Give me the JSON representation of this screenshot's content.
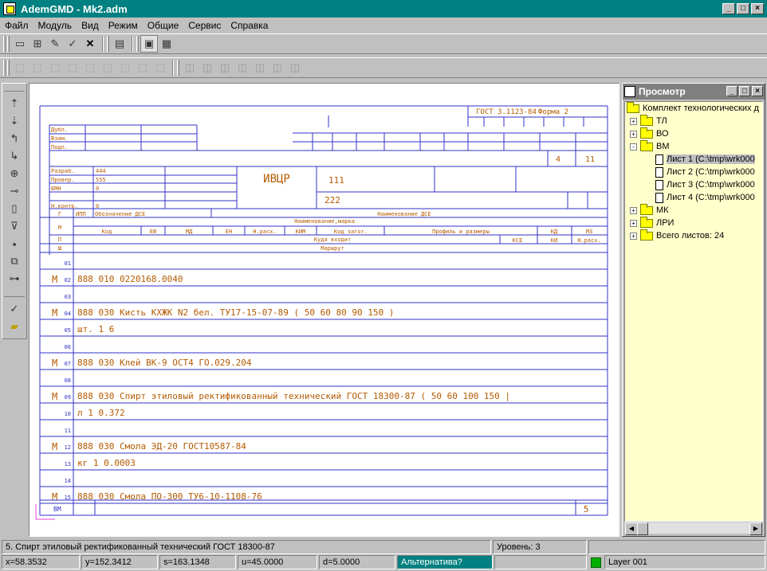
{
  "window": {
    "title": "AdemGMD - Mk2.adm"
  },
  "menu": [
    "Файл",
    "Модуль",
    "Вид",
    "Режим",
    "Общие",
    "Сервис",
    "Справка"
  ],
  "viewer": {
    "title": "Просмотр",
    "root": "Комплект технологических д",
    "folders": [
      "ТЛ",
      "ВО",
      "ВМ"
    ],
    "sheets": [
      "Лист 1 (C:\\tmp\\wrk000",
      "Лист 2 (C:\\tmp\\wrk000",
      "Лист 3 (C:\\tmp\\wrk000",
      "Лист 4 (C:\\tmp\\wrk000"
    ],
    "folders2": [
      "МК",
      "ЛРИ"
    ],
    "total": "Всего листов: 24"
  },
  "form": {
    "standard": "ГОСТ  3.1123-84",
    "form_no": "Форма  2",
    "side_labels": [
      "Дубл.",
      "Взам.",
      "Подл."
    ],
    "sheet": "4",
    "sheets_total": "11",
    "roles": [
      "Разраб.",
      "Провер.",
      "БМН",
      "",
      "Н.контр."
    ],
    "names": [
      "444",
      "555",
      "0",
      "",
      "0"
    ],
    "org": "ИВЦР",
    "doc_code": "111",
    "doc_code2": "222",
    "designation_header": "Обозначение ДСЕ",
    "name_header": "Наименование ДСЕ",
    "material_header": "Наименование,марка",
    "col_headers": [
      "Код",
      "ЕВ",
      "МД",
      "ЕН",
      "Н.расх.",
      "КИМ",
      "Код загот.",
      "Профиль и размеры",
      "КД",
      "МЗ"
    ],
    "to_header": "Куда входит",
    "kse": "КСЕ",
    "ki": "КИ",
    "nrash": "Н.расх.",
    "route_header": "Маршрут",
    "row_letters": [
      "Г",
      "М",
      "П",
      "Ш"
    ],
    "ipp": "ИПП",
    "rows": [
      {
        "n": "01",
        "m": "",
        "t": ""
      },
      {
        "n": "02",
        "m": "М",
        "t": "888        010   0220168.0040"
      },
      {
        "n": "03",
        "m": "",
        "t": ""
      },
      {
        "n": "04",
        "m": "М",
        "t": "888        030   Кисть  КХЖК  N2  бел.  ТУ17-15-07-89    ( 50  60  80  90  150  )"
      },
      {
        "n": "05",
        "m": "",
        "t": "                  шт.            1        6"
      },
      {
        "n": "06",
        "m": "",
        "t": ""
      },
      {
        "n": "07",
        "m": "М",
        "t": "888        030   Клей  ВК-9  ОСТ4  ГО.029.204"
      },
      {
        "n": "08",
        "m": "",
        "t": ""
      },
      {
        "n": "09",
        "m": "М",
        "t": "888        030   Спирт  этиловый  ректификованный  технический  ГОСТ  18300-87    ( 50  60  100  150  |"
      },
      {
        "n": "10",
        "m": "",
        "t": "                    л              1       0.372"
      },
      {
        "n": "11",
        "m": "",
        "t": ""
      },
      {
        "n": "12",
        "m": "М",
        "t": "888        030   Смола  ЭД-20  ГОСТ10587-84"
      },
      {
        "n": "13",
        "m": "",
        "t": "                   кг            1      0.0003"
      },
      {
        "n": "14",
        "m": "",
        "t": ""
      },
      {
        "n": "15",
        "m": "М",
        "t": "888        030   Смола  ПО-300  ТУ6-10-1108-76"
      }
    ],
    "footer_left": "ВМ",
    "footer_num": "5"
  },
  "statusbar": {
    "message": "5. Спирт этиловый ректификованный технический ГОСТ 18300-87",
    "level": "Уровень: 3",
    "x": "x=58.3532",
    "y": "y=152.3412",
    "s": "s=163.1348",
    "u": "u=45.0000",
    "d": "d=5.0000",
    "alt": "Альтернатива?",
    "layer": "Layer 001"
  },
  "colors": {
    "form": "#3232c8",
    "text": "#b45a00",
    "title": "#008080"
  }
}
